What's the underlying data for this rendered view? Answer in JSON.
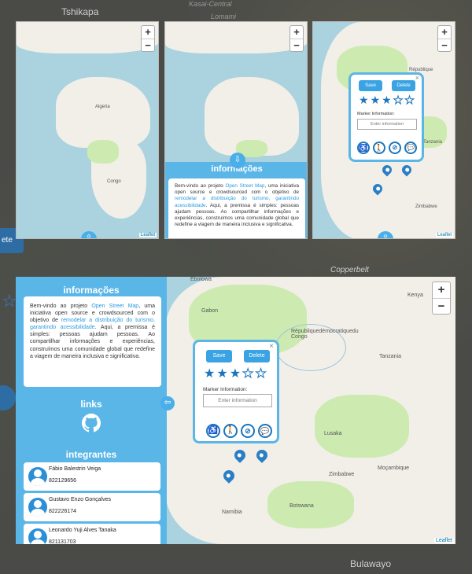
{
  "background": {
    "labels": [
      "Tshikapa",
      "Kasai-Central",
      "Lomami",
      "Copperbelt",
      "Bulawayo"
    ],
    "button_fragment": "ete"
  },
  "map": {
    "zoom_in": "+",
    "zoom_out": "−",
    "attribution": "Leaflet",
    "labels": [
      "Gabon",
      "Républiquedémocratiquedu Congo",
      "Tanzania",
      "Zimbabwe",
      "Namibia",
      "Botswana",
      "Moçambique",
      "Lusaka",
      "Ebolowa",
      "Kenya"
    ]
  },
  "info": {
    "title": "informações",
    "text_before_link1": "Bem-vindo ao projeto ",
    "link1": "Open Street Map",
    "text_between": ", uma iniciativa open source e crowdsourced com o objetivo de ",
    "link2": "remodelar a distribuição do turismo, garantindo acessibilidade",
    "text_after": ". Aqui, a premissa é simples: pessoas ajudam pessoas. Ao compartilhar informações e experiências, construímos uma comunidade global que redefine a viagem de maneira inclusiva e significativa."
  },
  "popup": {
    "save_label": "Save",
    "delete_label": "Delete",
    "close": "×",
    "rating": 3,
    "rating_max": 5,
    "marker_label": "Marker Information:",
    "input_placeholder": "Enter information",
    "accessibility_icons": [
      "wheelchair-icon",
      "walking-person-icon",
      "deaf-icon",
      "speech-bubble-icon"
    ]
  },
  "links": {
    "title": "links",
    "icon": "github-icon"
  },
  "members": {
    "title": "integrantes",
    "list": [
      {
        "name": "Fábio Balestrin Veiga",
        "phone": "822129656"
      },
      {
        "name": "Gustavo Enzo Gonçalves",
        "phone": "822226174"
      },
      {
        "name": "Leonardo Yuji Alves Tanaka",
        "phone": "821131703"
      }
    ]
  },
  "colors": {
    "accent": "#5bb6e8",
    "button": "#3aa3e3",
    "star": "#1c75bc",
    "water": "#aad3df",
    "land": "#f2efe9"
  }
}
